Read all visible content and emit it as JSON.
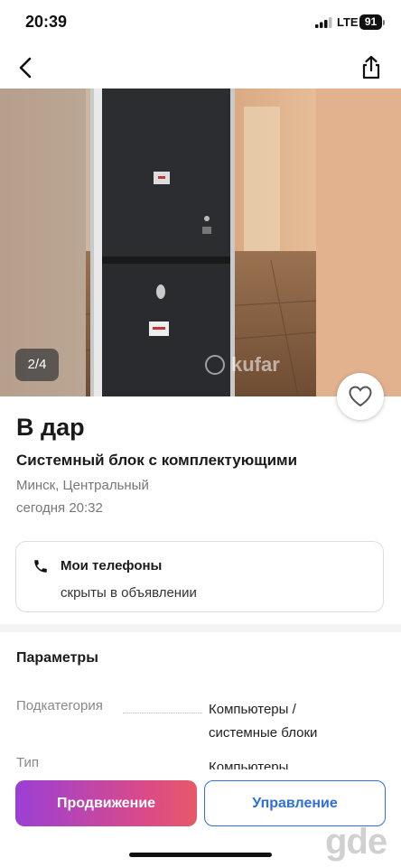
{
  "status": {
    "time": "20:39",
    "network": "LTE",
    "battery": "91"
  },
  "nav": {
    "back_icon": "chevron-left-icon",
    "share_icon": "share-icon"
  },
  "gallery": {
    "counter": "2/4",
    "watermark": "kufar"
  },
  "listing": {
    "price": "В дар",
    "title": "Системный блок с комплектующими",
    "location": "Минск, Центральный",
    "date": "сегодня 20:32"
  },
  "phones": {
    "title": "Мои телефоны",
    "subtitle": "скрыты в объявлении"
  },
  "params": {
    "heading": "Параметры",
    "rows": [
      {
        "label": "Подкатегория",
        "value_line1": "Компьютеры /",
        "value_line2": "системные блоки"
      },
      {
        "label": "Тип",
        "value_line1": "Компьютеры",
        "value_line2": ""
      }
    ]
  },
  "actions": {
    "promote": "Продвижение",
    "manage": "Управление"
  },
  "colors": {
    "accent_blue": "#2f6fdb",
    "promo_start": "#9b3fd6",
    "promo_end": "#e8586a"
  },
  "corner_watermark": "gde"
}
